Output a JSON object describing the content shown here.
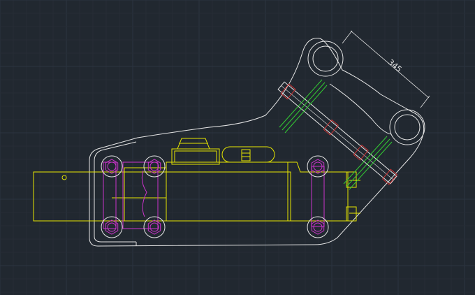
{
  "drawing": {
    "dimension_value": "345"
  },
  "layers": {
    "outline": "#e6e6e6",
    "yellow": "#e6e600",
    "magenta": "#cc33cc",
    "green": "#33cc33",
    "red_hatch": "#cc3333",
    "grid_major": "#2c3440",
    "grid_minor": "#262d36"
  }
}
